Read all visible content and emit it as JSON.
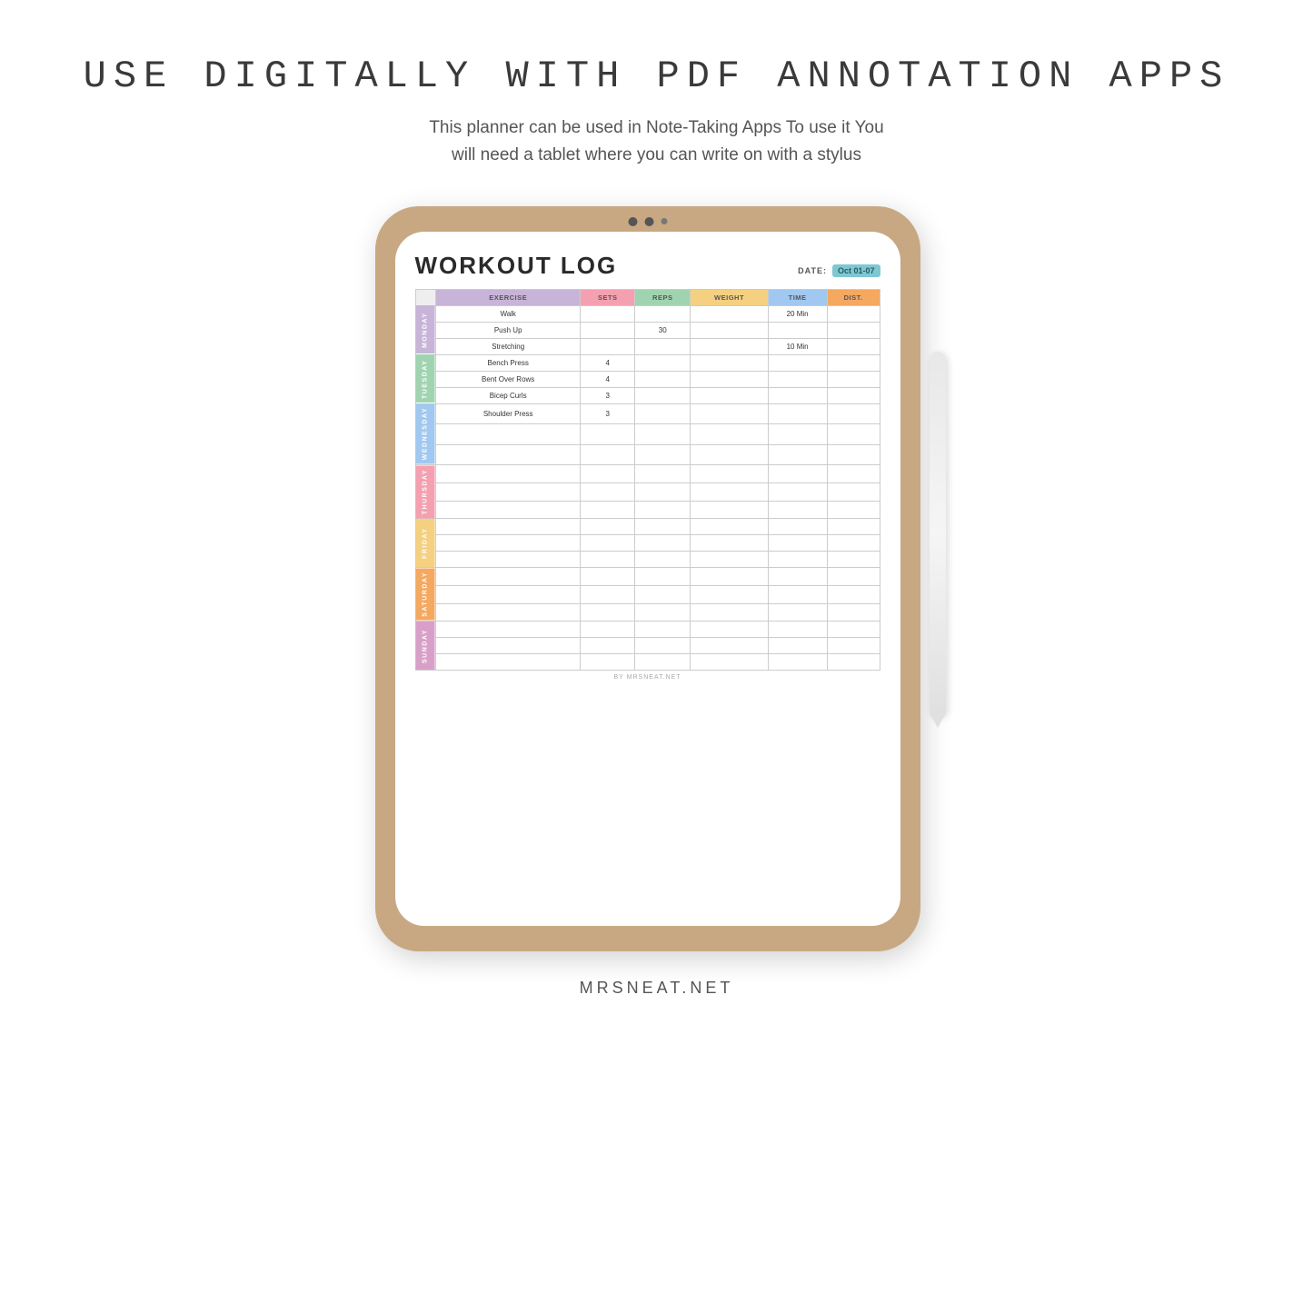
{
  "header": {
    "title": "USE DIGITALLY WITH PDF ANNOTATION APPS",
    "subtitle_line1": "This planner can be used in Note-Taking Apps  To use it You",
    "subtitle_line2": "will need a tablet where you can write on with a stylus"
  },
  "footer": {
    "brand": "MRSNEAT.NET"
  },
  "workout_log": {
    "title": "WORKOUT LOG",
    "date_label": "DATE:",
    "date_value": "Oct 01-07",
    "columns": [
      "EXERCISE",
      "SETS",
      "REPS",
      "WEIGHT",
      "TIME",
      "DIST."
    ],
    "footer": "BY MRSNEAT.NET",
    "days": [
      {
        "name": "MONDAY",
        "rows": [
          {
            "exercise": "Walk",
            "sets": "",
            "reps": "",
            "weight": "",
            "time": "20 Min",
            "dist": ""
          },
          {
            "exercise": "Push Up",
            "sets": "",
            "reps": "30",
            "weight": "",
            "time": "",
            "dist": ""
          },
          {
            "exercise": "Stretching",
            "sets": "",
            "reps": "",
            "weight": "",
            "time": "10 Min",
            "dist": ""
          }
        ]
      },
      {
        "name": "TUESDAY",
        "rows": [
          {
            "exercise": "Bench Press",
            "sets": "4",
            "reps": "",
            "weight": "",
            "time": "",
            "dist": ""
          },
          {
            "exercise": "Bent Over Rows",
            "sets": "4",
            "reps": "",
            "weight": "",
            "time": "",
            "dist": ""
          },
          {
            "exercise": "Bicep Curls",
            "sets": "3",
            "reps": "",
            "weight": "",
            "time": "",
            "dist": ""
          }
        ]
      },
      {
        "name": "WEDNESDAY",
        "rows": [
          {
            "exercise": "Shoulder Press",
            "sets": "3",
            "reps": "",
            "weight": "",
            "time": "",
            "dist": ""
          },
          {
            "exercise": "",
            "sets": "",
            "reps": "",
            "weight": "",
            "time": "",
            "dist": ""
          },
          {
            "exercise": "",
            "sets": "",
            "reps": "",
            "weight": "",
            "time": "",
            "dist": ""
          }
        ]
      },
      {
        "name": "THURSDAY",
        "rows": [
          {
            "exercise": "",
            "sets": "",
            "reps": "",
            "weight": "",
            "time": "",
            "dist": ""
          },
          {
            "exercise": "",
            "sets": "",
            "reps": "",
            "weight": "",
            "time": "",
            "dist": ""
          },
          {
            "exercise": "",
            "sets": "",
            "reps": "",
            "weight": "",
            "time": "",
            "dist": ""
          }
        ]
      },
      {
        "name": "FRIDAY",
        "rows": [
          {
            "exercise": "",
            "sets": "",
            "reps": "",
            "weight": "",
            "time": "",
            "dist": ""
          },
          {
            "exercise": "",
            "sets": "",
            "reps": "",
            "weight": "",
            "time": "",
            "dist": ""
          },
          {
            "exercise": "",
            "sets": "",
            "reps": "",
            "weight": "",
            "time": "",
            "dist": ""
          }
        ]
      },
      {
        "name": "SATURDAY",
        "rows": [
          {
            "exercise": "",
            "sets": "",
            "reps": "",
            "weight": "",
            "time": "",
            "dist": ""
          },
          {
            "exercise": "",
            "sets": "",
            "reps": "",
            "weight": "",
            "time": "",
            "dist": ""
          },
          {
            "exercise": "",
            "sets": "",
            "reps": "",
            "weight": "",
            "time": "",
            "dist": ""
          }
        ]
      },
      {
        "name": "SUNDAY",
        "rows": [
          {
            "exercise": "",
            "sets": "",
            "reps": "",
            "weight": "",
            "time": "",
            "dist": ""
          },
          {
            "exercise": "",
            "sets": "",
            "reps": "",
            "weight": "",
            "time": "",
            "dist": ""
          },
          {
            "exercise": "",
            "sets": "",
            "reps": "",
            "weight": "",
            "time": "",
            "dist": ""
          }
        ]
      }
    ]
  },
  "colors": {
    "monday": "#c8b4d8",
    "tuesday": "#a0d4b0",
    "wednesday": "#a0c8f0",
    "thursday": "#f4a0b0",
    "friday": "#f4d080",
    "saturday": "#f4a860",
    "sunday": "#d8a0c8"
  }
}
